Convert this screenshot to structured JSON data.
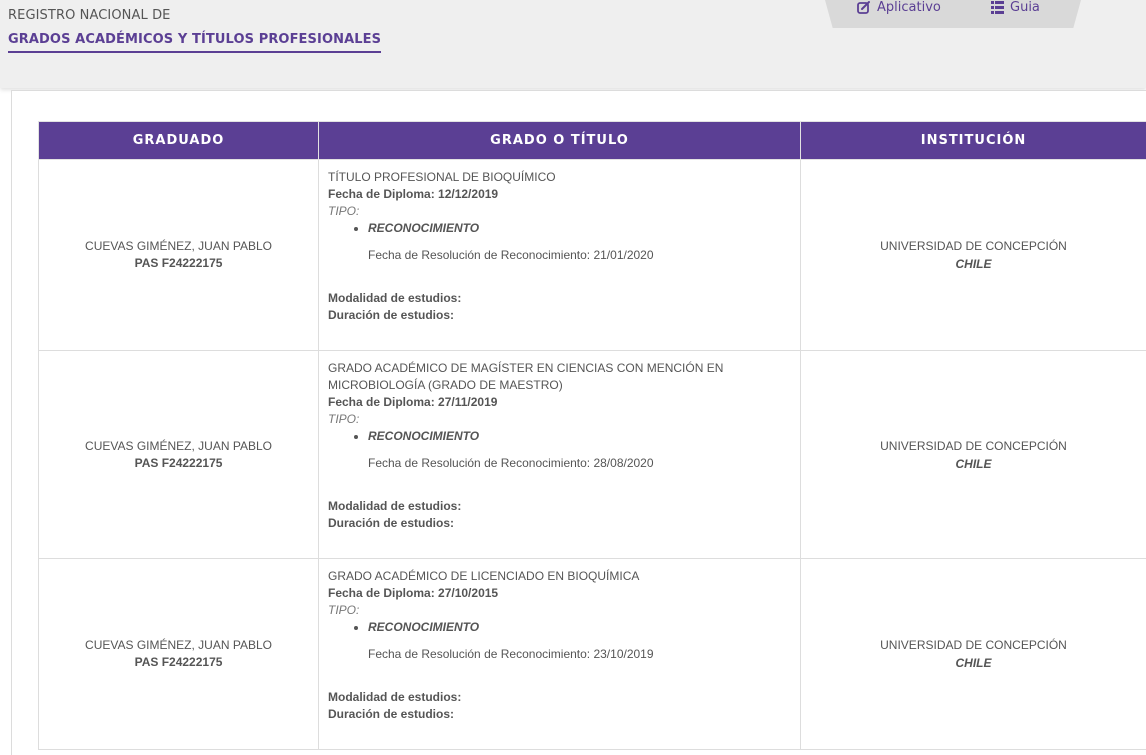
{
  "header": {
    "brand_top": "REGISTRO NACIONAL DE",
    "brand_main": "GRADOS ACADÉMICOS Y TÍTULOS PROFESIONALES",
    "nav": [
      {
        "label": "Aplicativo",
        "icon": "edit-icon"
      },
      {
        "label": "Guia",
        "icon": "list-icon"
      }
    ],
    "accent_color": "#5b3f94"
  },
  "table": {
    "columns": [
      "GRADUADO",
      "GRADO O TÍTULO",
      "INSTITUCIÓN"
    ],
    "rows": [
      {
        "graduado": "CUEVAS GIMÉNEZ, JUAN PABLO",
        "documento": "PAS F24222175",
        "titulo": "TÍTULO PROFESIONAL DE BIOQUÍMICO",
        "fecha_diploma_label": "Fecha de Diploma:",
        "fecha_diploma": "12/12/2019",
        "tipo_label": "TIPO:",
        "tipo": "RECONOCIMIENTO",
        "resolucion": "Fecha de Resolución de Reconocimiento: 21/01/2020",
        "modalidad_label": "Modalidad de estudios:",
        "duracion_label": "Duración de estudios:",
        "institucion": "UNIVERSIDAD DE CONCEPCIÓN",
        "pais": "CHILE"
      },
      {
        "graduado": "CUEVAS GIMÉNEZ, JUAN PABLO",
        "documento": "PAS F24222175",
        "titulo": "GRADO ACADÉMICO DE MAGÍSTER EN CIENCIAS CON MENCIÓN EN MICROBIOLOGÍA (GRADO DE MAESTRO)",
        "fecha_diploma_label": "Fecha de Diploma:",
        "fecha_diploma": "27/11/2019",
        "tipo_label": "TIPO:",
        "tipo": "RECONOCIMIENTO",
        "resolucion": "Fecha de Resolución de Reconocimiento: 28/08/2020",
        "modalidad_label": "Modalidad de estudios:",
        "duracion_label": "Duración de estudios:",
        "institucion": "UNIVERSIDAD DE CONCEPCIÓN",
        "pais": "CHILE"
      },
      {
        "graduado": "CUEVAS GIMÉNEZ, JUAN PABLO",
        "documento": "PAS F24222175",
        "titulo": "GRADO ACADÉMICO DE LICENCIADO EN BIOQUÍMICA",
        "fecha_diploma_label": "Fecha de Diploma:",
        "fecha_diploma": "27/10/2015",
        "tipo_label": "TIPO:",
        "tipo": "RECONOCIMIENTO",
        "resolucion": "Fecha de Resolución de Reconocimiento: 23/10/2019",
        "modalidad_label": "Modalidad de estudios:",
        "duracion_label": "Duración de estudios:",
        "institucion": "UNIVERSIDAD DE CONCEPCIÓN",
        "pais": "CHILE"
      }
    ]
  }
}
